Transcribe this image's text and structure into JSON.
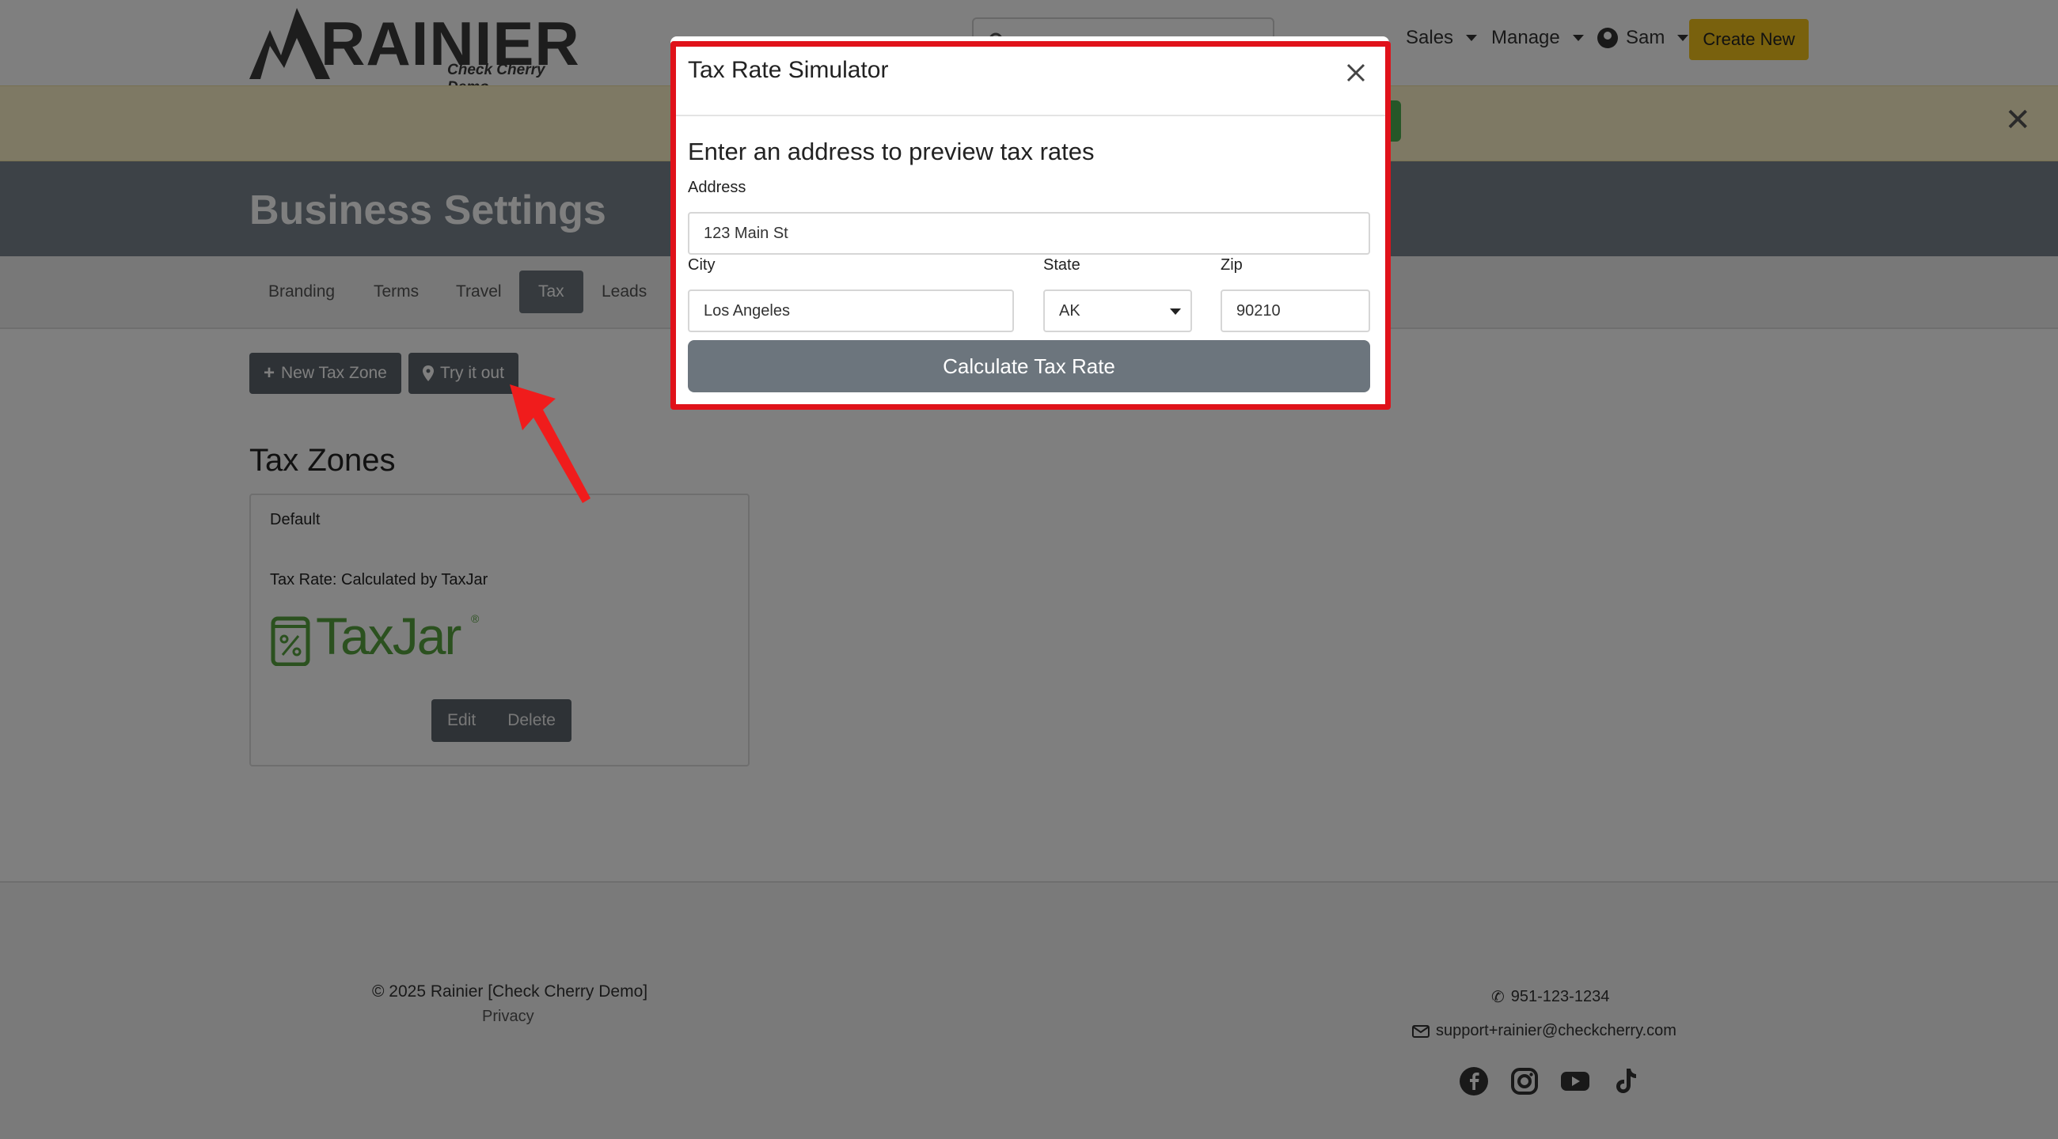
{
  "nav": {
    "logo_text": "RAINIER",
    "logo_subtitle": "Check Cherry Demo",
    "items": [
      {
        "label": "Sales"
      },
      {
        "label": "Manage"
      },
      {
        "label": "Sam"
      }
    ],
    "create_label": "Create New"
  },
  "header": {
    "title": "Business Settings"
  },
  "tabs": [
    {
      "label": "Branding"
    },
    {
      "label": "Terms"
    },
    {
      "label": "Travel"
    },
    {
      "label": "Tax"
    },
    {
      "label": "Leads"
    }
  ],
  "actions": {
    "new_zone_label": "New Tax Zone",
    "try_label": "Try it out"
  },
  "zones": {
    "title": "Tax Zones",
    "card": {
      "name": "Default",
      "rate_text": "Tax Rate: Calculated by TaxJar",
      "logo_text": "TaxJar",
      "logo_mark": "®",
      "edit_label": "Edit",
      "delete_label": "Delete"
    }
  },
  "footer": {
    "copyright": "© 2025 Rainier [Check Cherry Demo]",
    "privacy": "Privacy",
    "phone": "951-123-1234",
    "email": "support+rainier@checkcherry.com",
    "socials": [
      "facebook-icon",
      "instagram-icon",
      "youtube-icon",
      "tiktok-icon"
    ]
  },
  "modal": {
    "title": "Tax Rate Simulator",
    "heading": "Enter an address to preview tax rates",
    "address_label": "Address",
    "address_value": "123 Main St",
    "city_label": "City",
    "city_value": "Los Angeles",
    "state_label": "State",
    "state_value": "AK",
    "zip_label": "Zip",
    "zip_value": "90210",
    "submit_label": "Calculate Tax Rate"
  },
  "colors": {
    "accent_yellow": "#f2c21a",
    "header_gray": "#7a848e",
    "button_gray": "#6c757d",
    "highlight_red": "#e0121a",
    "taxjar_green": "#56a33e"
  }
}
